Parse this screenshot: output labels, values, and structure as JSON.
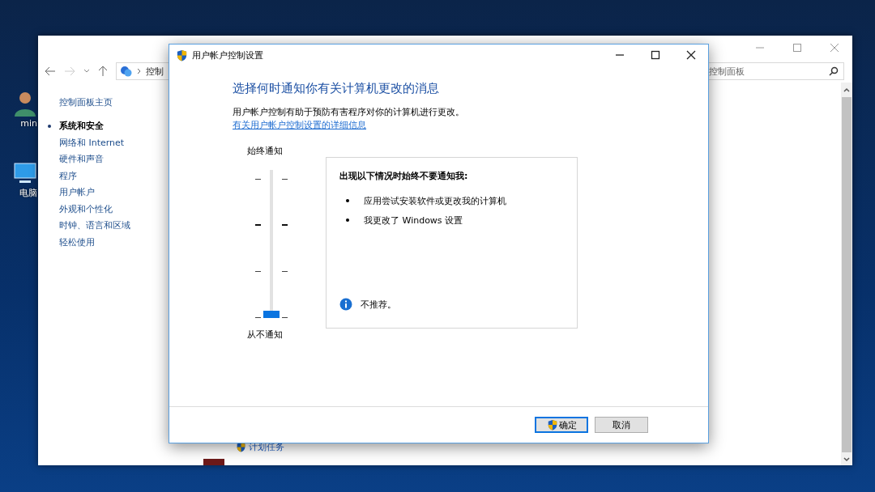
{
  "desktop": {
    "icons": [
      {
        "label": "min",
        "kind": "user"
      },
      {
        "label": "电脑",
        "kind": "computer"
      }
    ]
  },
  "control_panel": {
    "address": "控制",
    "search": {
      "placeholder": "控制面板"
    },
    "sidebar": {
      "items": [
        {
          "label": "控制面板主页",
          "selected": false
        },
        {
          "label": "系统和安全",
          "selected": true
        },
        {
          "label": "网络和 Internet",
          "selected": false
        },
        {
          "label": "硬件和声音",
          "selected": false
        },
        {
          "label": "程序",
          "selected": false
        },
        {
          "label": "用户帐户",
          "selected": false
        },
        {
          "label": "外观和个性化",
          "selected": false
        },
        {
          "label": "时钟、语言和区域",
          "selected": false
        },
        {
          "label": "轻松使用",
          "selected": false
        }
      ]
    },
    "task_link": "计划任务"
  },
  "dialog": {
    "title": "用户帐户控制设置",
    "heading": "选择何时通知你有关计算机更改的消息",
    "description": "用户帐户控制有助于预防有害程序对你的计算机进行更改。",
    "link": "有关用户帐户控制设置的详细信息",
    "slider": {
      "top_label": "始终通知",
      "bottom_label": "从不通知",
      "level": 0
    },
    "info": {
      "heading": "出现以下情况时始终不要通知我:",
      "bullets": [
        "应用尝试安装软件或更改我的计算机",
        "我更改了 Windows 设置"
      ],
      "note": "不推荐。"
    },
    "buttons": [
      {
        "label": "确定",
        "kind": "shield",
        "default": true
      },
      {
        "label": "取消",
        "kind": "plain",
        "default": false
      }
    ]
  }
}
